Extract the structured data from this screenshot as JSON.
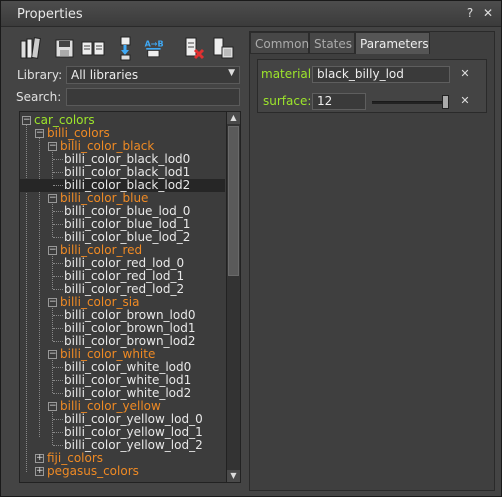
{
  "window": {
    "title": "Properties",
    "help_label": "?",
    "close_label": "✕"
  },
  "toolbar": {
    "icons": [
      "library-books-icon",
      "save-icon",
      "open-book-icon",
      "import-icon",
      "rename-icon",
      "delete-icon",
      "copy-icon"
    ],
    "rename_label": "A→B"
  },
  "library": {
    "label": "Library:",
    "value": "All libraries"
  },
  "search": {
    "label": "Search:",
    "value": ""
  },
  "tree": {
    "items": [
      {
        "label": "car_colors",
        "color": "green",
        "level": 0,
        "toggle": "−"
      },
      {
        "label": "billi_colors",
        "color": "orange",
        "level": 1,
        "toggle": "−"
      },
      {
        "label": "billi_color_black",
        "color": "orange",
        "level": 2,
        "toggle": "−"
      },
      {
        "label": "billi_color_black_lod0",
        "color": "white",
        "level": 3
      },
      {
        "label": "billi_color_black_lod1",
        "color": "white",
        "level": 3
      },
      {
        "label": "billi_color_black_lod2",
        "color": "white",
        "level": 3,
        "selected": true
      },
      {
        "label": "billi_color_blue",
        "color": "orange",
        "level": 2,
        "toggle": "−"
      },
      {
        "label": "billi_color_blue_lod_0",
        "color": "white",
        "level": 3
      },
      {
        "label": "billi_color_blue_lod_1",
        "color": "white",
        "level": 3
      },
      {
        "label": "billi_color_blue_lod_2",
        "color": "white",
        "level": 3
      },
      {
        "label": "billi_color_red",
        "color": "orange",
        "level": 2,
        "toggle": "−"
      },
      {
        "label": "billi_color_red_lod_0",
        "color": "white",
        "level": 3
      },
      {
        "label": "billi_color_red_lod_1",
        "color": "white",
        "level": 3
      },
      {
        "label": "billi_color_red_lod_2",
        "color": "white",
        "level": 3
      },
      {
        "label": "billi_color_sia",
        "color": "orange",
        "level": 2,
        "toggle": "−"
      },
      {
        "label": "billi_color_brown_lod0",
        "color": "white",
        "level": 3
      },
      {
        "label": "billi_color_brown_lod1",
        "color": "white",
        "level": 3
      },
      {
        "label": "billi_color_brown_lod2",
        "color": "white",
        "level": 3
      },
      {
        "label": "billi_color_white",
        "color": "orange",
        "level": 2,
        "toggle": "−"
      },
      {
        "label": "billi_color_white_lod0",
        "color": "white",
        "level": 3
      },
      {
        "label": "billi_color_white_lod1",
        "color": "white",
        "level": 3
      },
      {
        "label": "billi_color_white_lod2",
        "color": "white",
        "level": 3
      },
      {
        "label": "billi_color_yellow",
        "color": "orange",
        "level": 2,
        "toggle": "−"
      },
      {
        "label": "billi_color_yellow_lod_0",
        "color": "white",
        "level": 3
      },
      {
        "label": "billi_color_yellow_lod_1",
        "color": "white",
        "level": 3
      },
      {
        "label": "billi_color_yellow_lod_2",
        "color": "white",
        "level": 3
      },
      {
        "label": "fiji_colors",
        "color": "orange",
        "level": 1,
        "toggle": "+"
      },
      {
        "label": "pegasus_colors",
        "color": "orange",
        "level": 1,
        "toggle": "+"
      }
    ]
  },
  "tabs": [
    {
      "label": "Common",
      "active": false
    },
    {
      "label": "States",
      "active": false
    },
    {
      "label": "Parameters",
      "active": true
    }
  ],
  "params": {
    "material_label": "material:",
    "material_value": "black_billy_lod",
    "surface_label": "surface:",
    "surface_value": "12",
    "surface_slider_level": 1.0,
    "label_color": "#9de52b"
  },
  "colors": {
    "green": "#9de52b",
    "orange": "#ef8a24",
    "text": "#e8e8e8"
  }
}
